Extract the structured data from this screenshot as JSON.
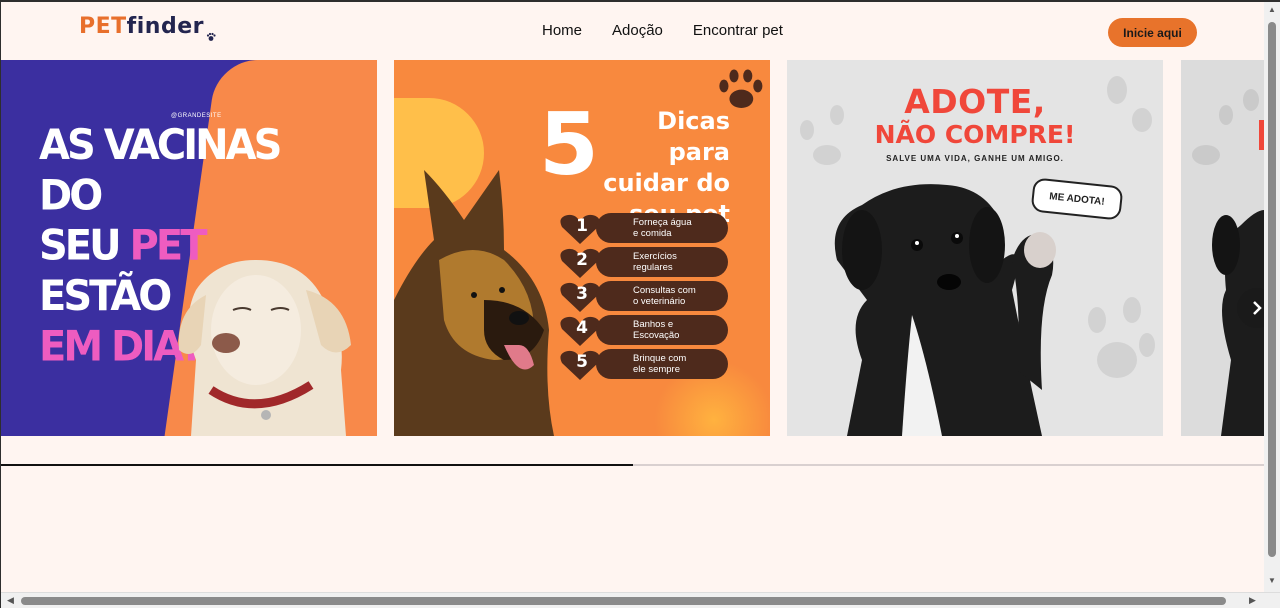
{
  "header": {
    "logo_part1": "PET",
    "logo_part2": "finder",
    "nav": [
      "Home",
      "Adoção",
      "Encontrar pet"
    ],
    "cta_label": "Inicie aqui"
  },
  "carousel": {
    "slide1": {
      "handle": "@GRANDESITE",
      "line1": "AS VACINAS DO",
      "line2_a": "SEU ",
      "line2_b": "PET",
      "line2_c": " ESTÃO",
      "line3": "EM DIA?"
    },
    "slide2": {
      "big_number": "5",
      "title": "Dicas para cuidar do seu pet",
      "tips": [
        {
          "n": "1",
          "l1": "Forneça água",
          "l2": "e comida"
        },
        {
          "n": "2",
          "l1": "Exercícios",
          "l2": "regulares"
        },
        {
          "n": "3",
          "l1": "Consultas com",
          "l2": "o veterinário"
        },
        {
          "n": "4",
          "l1": "Banhos e",
          "l2": "Escovação"
        },
        {
          "n": "5",
          "l1": "Brinque com",
          "l2": "ele sempre"
        }
      ]
    },
    "slide3": {
      "line1": "ADOTE,",
      "line2": "NÃO COMPRE!",
      "subtitle": "SALVE UMA VIDA, GANHE UM AMIGO.",
      "bubble": "ME ADOTA!"
    },
    "next_icon": "chevron-right-icon",
    "progress": 0.5
  },
  "colors": {
    "accent": "#e8732b",
    "background": "#fff5f1",
    "brand_dark": "#23254f"
  }
}
